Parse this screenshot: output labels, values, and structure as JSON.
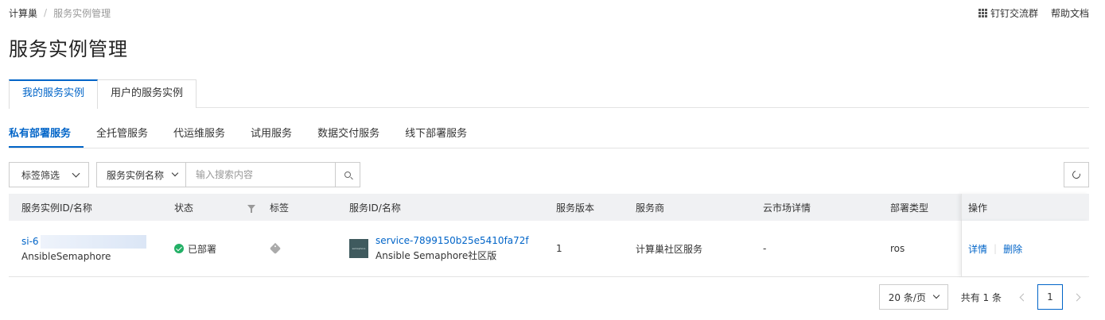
{
  "breadcrumb": {
    "root": "计算巢",
    "separator": "/",
    "current": "服务实例管理"
  },
  "top_links": {
    "dingtalk": "钉钉交流群",
    "help": "帮助文档"
  },
  "page_title": "服务实例管理",
  "main_tabs": [
    {
      "label": "我的服务实例",
      "active": true
    },
    {
      "label": "用户的服务实例",
      "active": false
    }
  ],
  "sub_tabs": [
    {
      "label": "私有部署服务",
      "active": true
    },
    {
      "label": "全托管服务",
      "active": false
    },
    {
      "label": "代运维服务",
      "active": false
    },
    {
      "label": "试用服务",
      "active": false
    },
    {
      "label": "数据交付服务",
      "active": false
    },
    {
      "label": "线下部署服务",
      "active": false
    }
  ],
  "toolbar": {
    "tag_filter_label": "标签筛选",
    "search_field_label": "服务实例名称",
    "search_placeholder": "输入搜索内容"
  },
  "table": {
    "columns": [
      "服务实例ID/名称",
      "状态",
      "标签",
      "服务ID/名称",
      "服务版本",
      "服务商",
      "云市场详情",
      "部署类型",
      "操作"
    ],
    "rows": [
      {
        "instance_id": "si-6",
        "instance_name": "AnsibleSemaphore",
        "status": "已部署",
        "service_id": "service-7899150b25e5410fa72f",
        "service_name": "Ansible Semaphore社区版",
        "version": "1",
        "provider": "计算巢社区服务",
        "marketplace": "-",
        "deploy_type": "ros",
        "actions": {
          "detail": "详情",
          "delete": "删除"
        }
      }
    ]
  },
  "pagination": {
    "page_size": "20 条/页",
    "total": "共有 1 条",
    "current_page": "1"
  },
  "colors": {
    "accent": "#0064c8",
    "success": "#23b066",
    "header_bg": "#f0f1f3"
  }
}
